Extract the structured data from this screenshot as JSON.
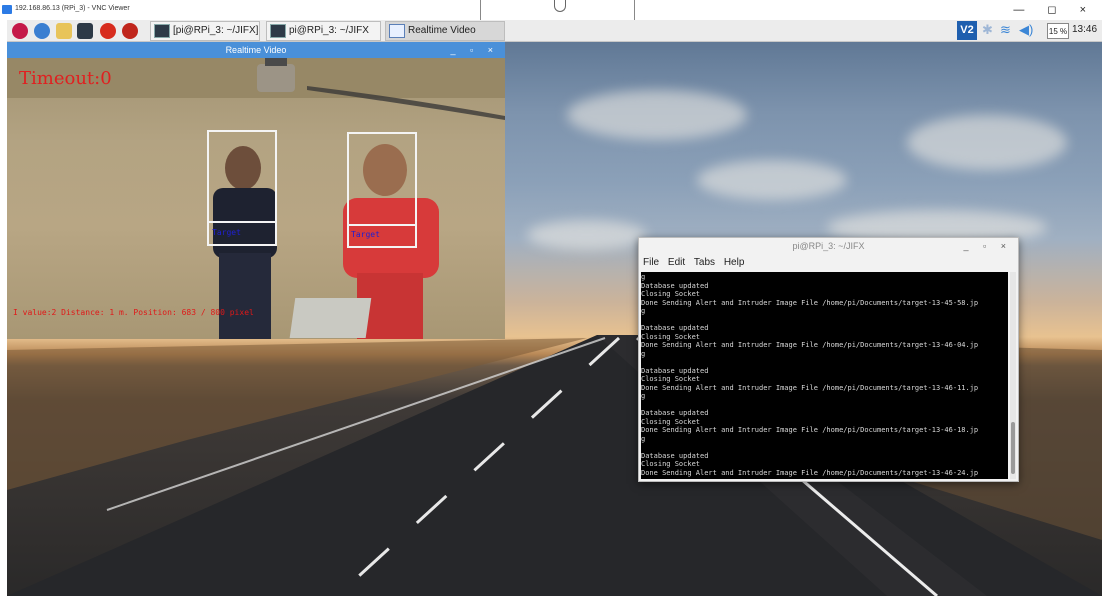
{
  "vnc": {
    "title": "192.168.86.13 (RPi_3) - VNC Viewer",
    "window_buttons": "— ◻ ×"
  },
  "taskbar": {
    "launchers": [
      "raspberry-icon",
      "globe-icon",
      "folder-icon",
      "terminal-icon",
      "settings-icon",
      "vnc-icon"
    ],
    "tasks": [
      {
        "label": "[pi@RPi_3: ~/JIFX]"
      },
      {
        "label": "pi@RPi_3: ~/JIFX"
      },
      {
        "label": "Realtime Video"
      }
    ],
    "tray": {
      "vnc_label": "V2",
      "cpu_label": "15 %",
      "clock": "13:46"
    }
  },
  "video_window": {
    "title": "Realtime Video",
    "window_buttons": "_ ▫ ×",
    "timeout_label": "Timeout:0",
    "status_text": "I value:2 Distance: 1 m. Position: 683 / 800 pixel",
    "targets": [
      {
        "label": "Target"
      },
      {
        "label": "Target"
      }
    ]
  },
  "terminal": {
    "title": "pi@RPi_3: ~/JIFX",
    "window_buttons": "_ ▫ ×",
    "menu": [
      "File",
      "Edit",
      "Tabs",
      "Help"
    ],
    "lines": [
      "g",
      "Database updated",
      "Closing Socket",
      "Done Sending Alert and Intruder Image File /home/pi/Documents/target-13-45-58.jp",
      "g",
      "",
      "Database updated",
      "Closing Socket",
      "Done Sending Alert and Intruder Image File /home/pi/Documents/target-13-46-04.jp",
      "g",
      "",
      "Database updated",
      "Closing Socket",
      "Done Sending Alert and Intruder Image File /home/pi/Documents/target-13-46-11.jp",
      "g",
      "",
      "Database updated",
      "Closing Socket",
      "Done Sending Alert and Intruder Image File /home/pi/Documents/target-13-46-18.jp",
      "g",
      "",
      "Database updated",
      "Closing Socket",
      "Done Sending Alert and Intruder Image File /home/pi/Documents/target-13-46-24.jp",
      "g",
      "",
      "Database updated",
      "Closing Socket",
      "▯"
    ]
  }
}
